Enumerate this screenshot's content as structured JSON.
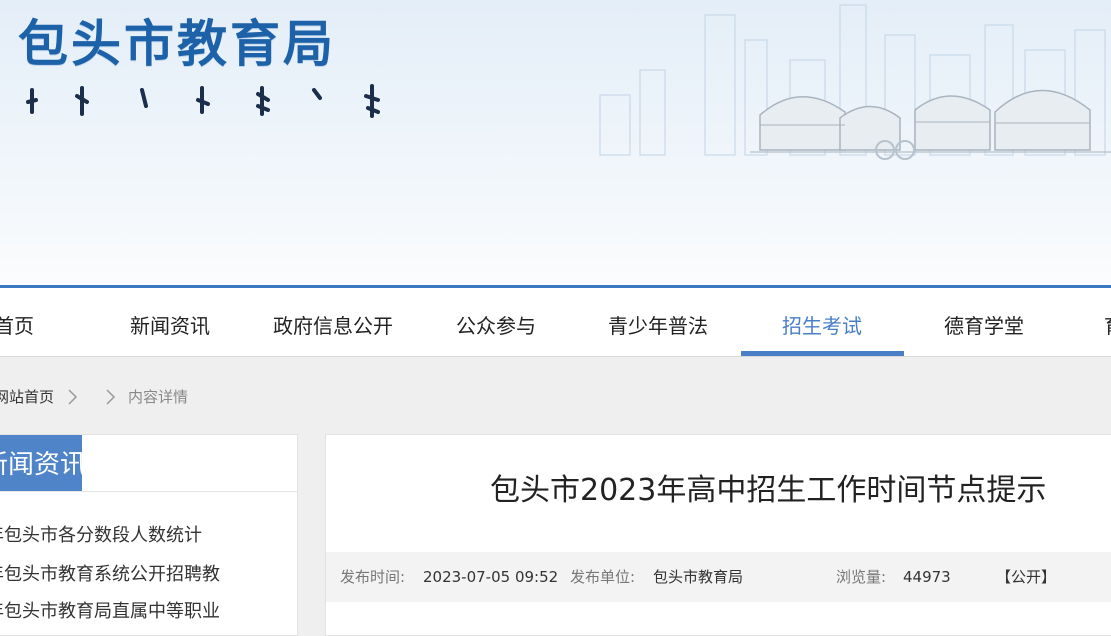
{
  "header": {
    "site_title": "包头市教育局",
    "mongolian_script": "ᠪᠤᠭᠤᠲᠤ ᠬᠣᠲᠠ"
  },
  "nav": {
    "items": [
      {
        "label": "首页"
      },
      {
        "label": "新闻资讯"
      },
      {
        "label": "政府信息公开"
      },
      {
        "label": "公众参与"
      },
      {
        "label": "青少年普法"
      },
      {
        "label": "招生考试"
      },
      {
        "label": "德育学堂"
      },
      {
        "label": "育"
      }
    ],
    "active_index": 5
  },
  "breadcrumb": {
    "home": "网站首页",
    "current": "内容详情"
  },
  "sidebar": {
    "heading": "新闻资讯",
    "items": [
      {
        "label": "年包头市各分数段人数统计"
      },
      {
        "label": "年包头市教育系统公开招聘教"
      },
      {
        "label": "年包头市教育局直属中等职业"
      }
    ]
  },
  "article": {
    "title": "包头市2023年高中招生工作时间节点提示",
    "meta": {
      "publish_time_label": "发布时间:",
      "publish_time": "2023-07-05 09:52",
      "publisher_label": "发布单位:",
      "publisher": "包头市教育局",
      "views_label": "浏览量:",
      "views": "44973",
      "disclosure": "【公开】"
    }
  },
  "colors": {
    "brand_blue": "#1d61a8",
    "accent_blue": "#4a7fc8",
    "sidebar_head": "#4f84c9"
  }
}
